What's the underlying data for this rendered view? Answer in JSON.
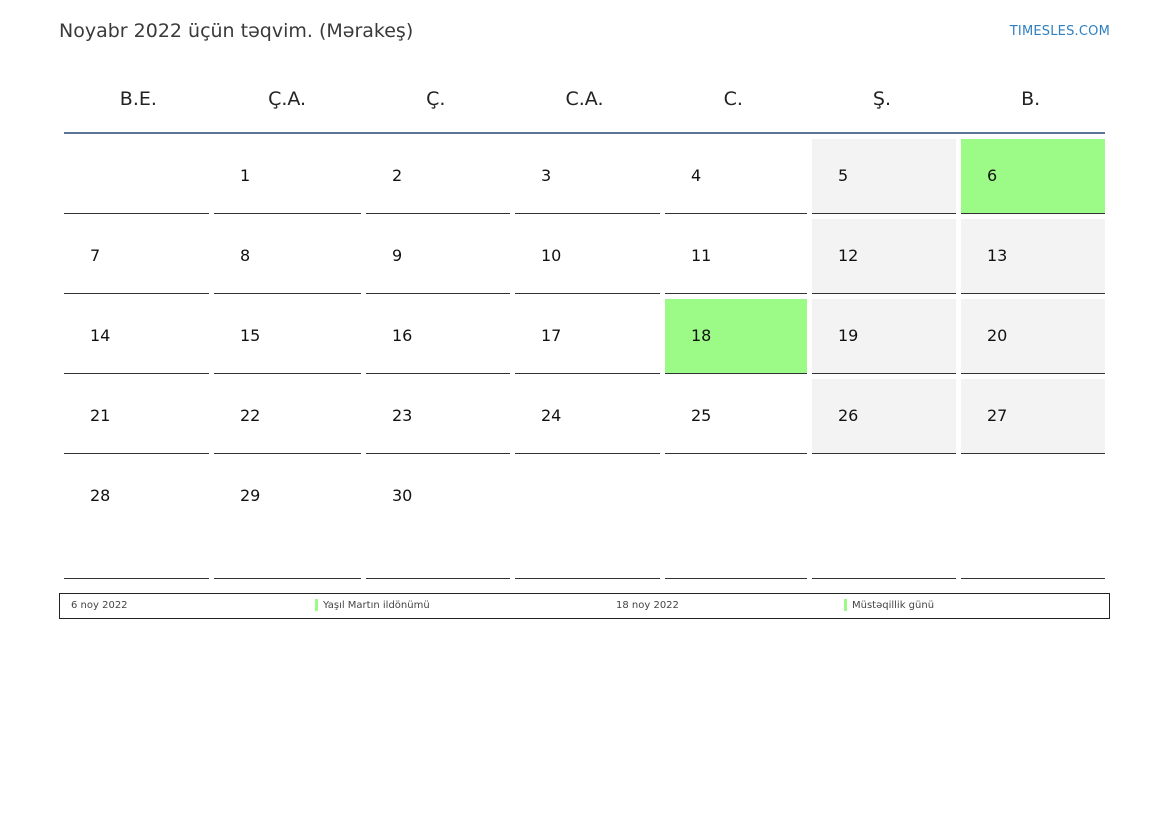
{
  "header": {
    "title": "Noyabr 2022 üçün təqvim. (Mərakeş)",
    "site": "TIMESLES.COM"
  },
  "weekdays": [
    "B.E.",
    "Ç.A.",
    "Ç.",
    "C.A.",
    "C.",
    "Ş.",
    "B."
  ],
  "weeks": [
    [
      {
        "d": ""
      },
      {
        "d": "1"
      },
      {
        "d": "2"
      },
      {
        "d": "3"
      },
      {
        "d": "4"
      },
      {
        "d": "5"
      },
      {
        "d": "6"
      }
    ],
    [
      {
        "d": "7"
      },
      {
        "d": "8"
      },
      {
        "d": "9"
      },
      {
        "d": "10"
      },
      {
        "d": "11"
      },
      {
        "d": "12"
      },
      {
        "d": "13"
      }
    ],
    [
      {
        "d": "14"
      },
      {
        "d": "15"
      },
      {
        "d": "16"
      },
      {
        "d": "17"
      },
      {
        "d": "18"
      },
      {
        "d": "19"
      },
      {
        "d": "20"
      }
    ],
    [
      {
        "d": "21"
      },
      {
        "d": "22"
      },
      {
        "d": "23"
      },
      {
        "d": "24"
      },
      {
        "d": "25"
      },
      {
        "d": "26"
      },
      {
        "d": "27"
      }
    ],
    [
      {
        "d": "28"
      },
      {
        "d": "29"
      },
      {
        "d": "30"
      },
      {
        "d": ""
      },
      {
        "d": ""
      },
      {
        "d": ""
      },
      {
        "d": ""
      }
    ]
  ],
  "holiday_days": [
    "6",
    "18"
  ],
  "colors": {
    "holiday": "#9cfb86",
    "weekend": "#f3f3f3",
    "header_rule": "#5b7597",
    "link": "#2f7fbf"
  },
  "legend": [
    {
      "date": "6 noy 2022",
      "name": "Yaşıl Martın ildönümü"
    },
    {
      "date": "18 noy 2022",
      "name": "Müstəqillik günü"
    }
  ]
}
